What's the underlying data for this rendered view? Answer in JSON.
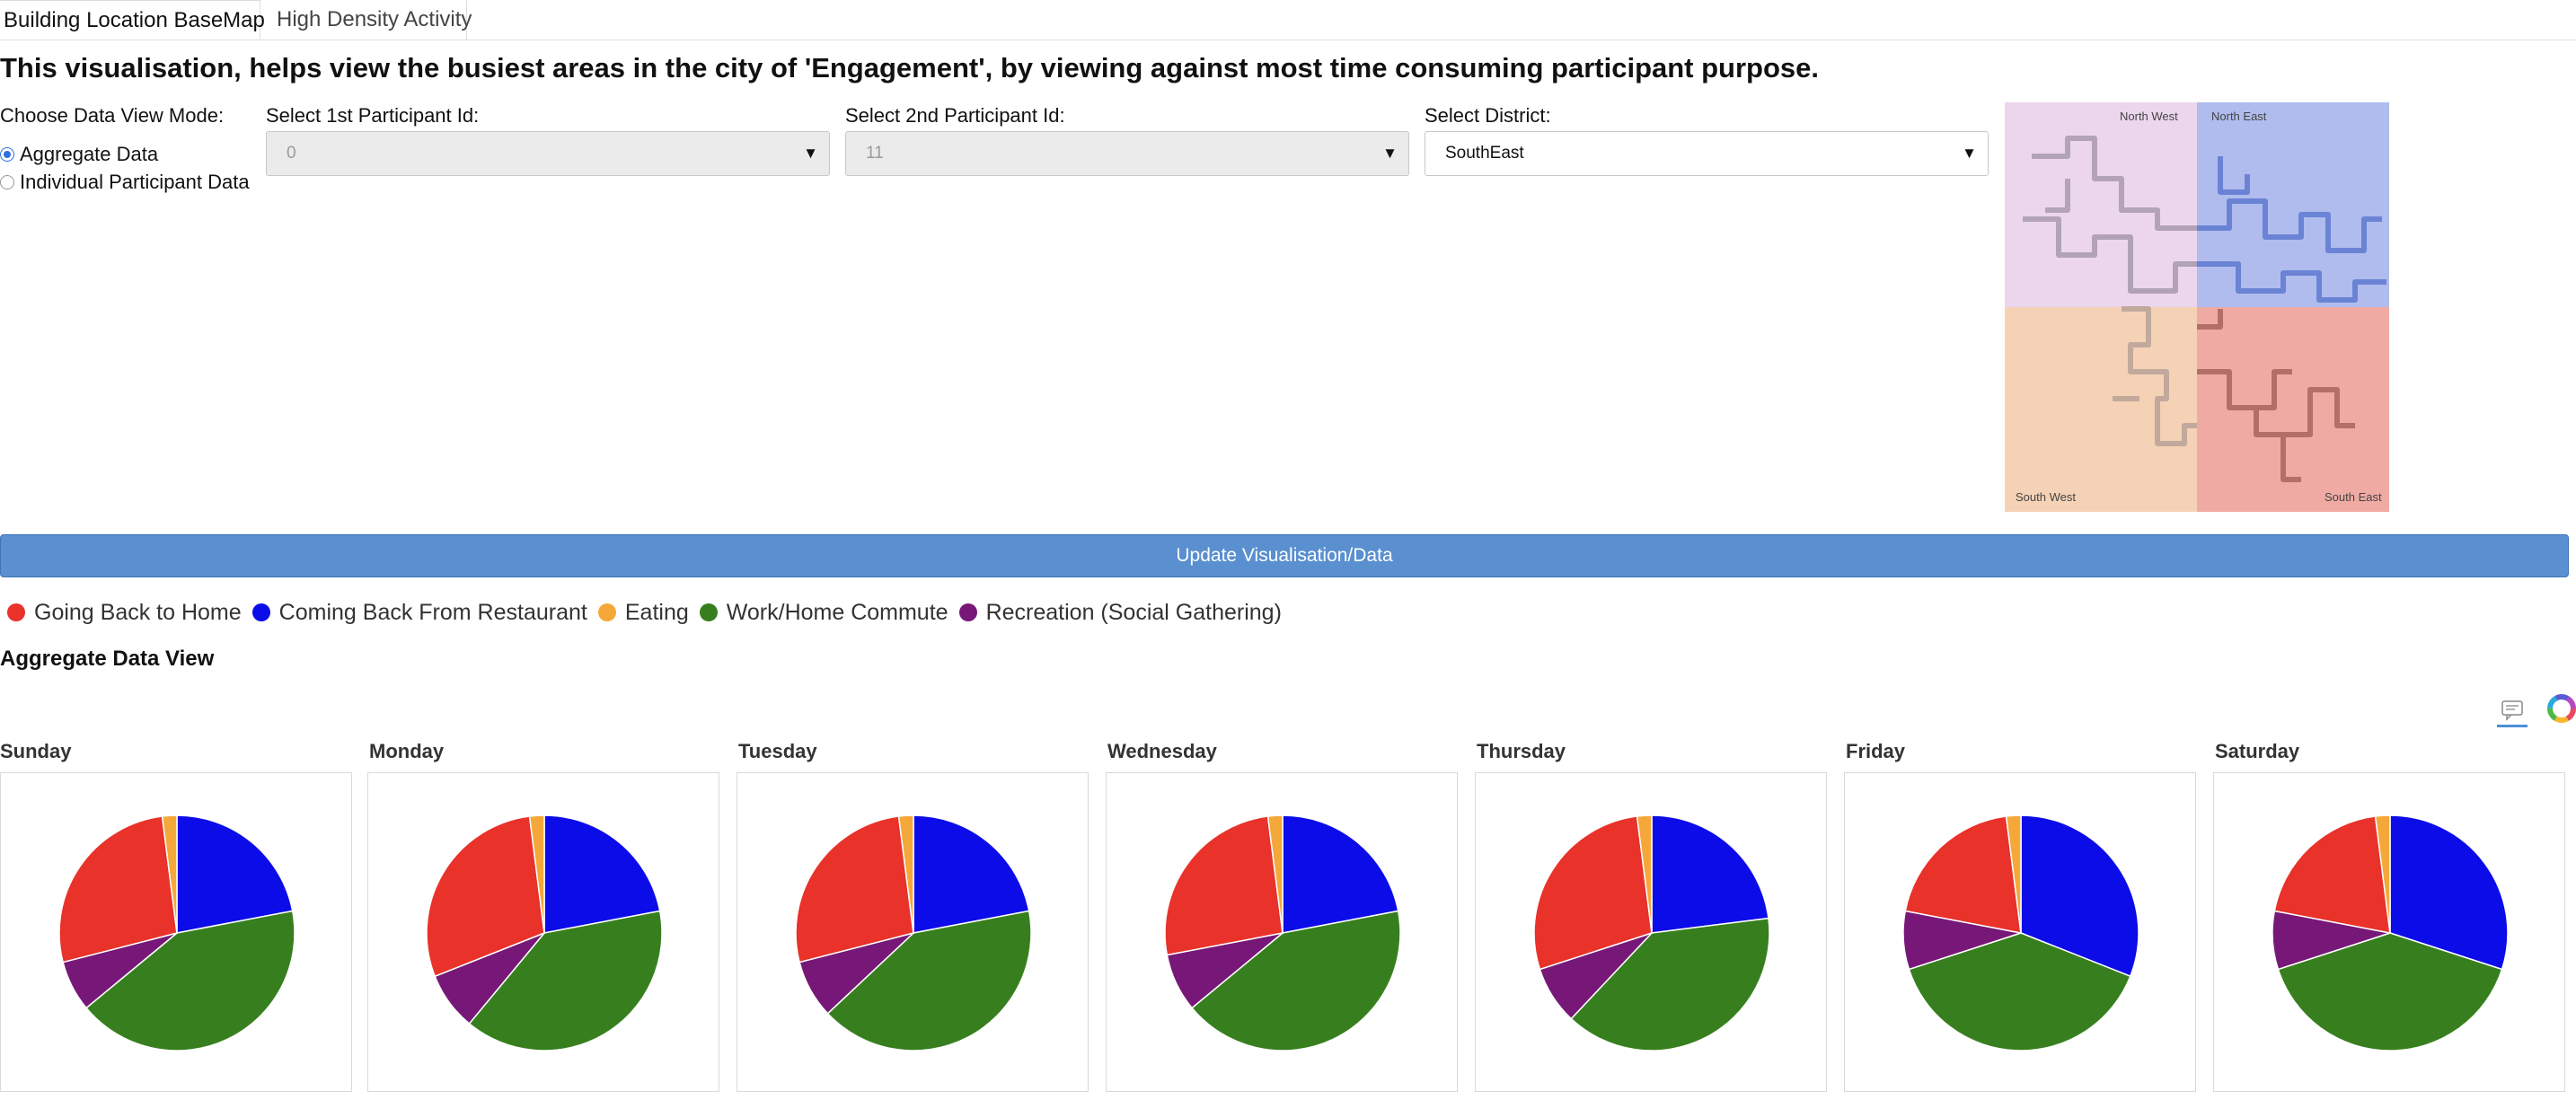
{
  "tabs": [
    "Building Location BaseMap",
    "High Density Activity"
  ],
  "heading": "This visualisation, helps view the busiest areas in the city of 'Engagement', by viewing against most time consuming participant purpose.",
  "controls": {
    "mode_label": "Choose Data View Mode:",
    "mode_options": [
      "Aggregate Data",
      "Individual Participant Data"
    ],
    "mode_selected": "Aggregate Data",
    "p1_label": "Select 1st Participant Id:",
    "p1_value": "0",
    "p2_label": "Select 2nd Participant Id:",
    "p2_value": "11",
    "district_label": "Select District:",
    "district_value": "SouthEast",
    "update_button": "Update Visualisation/Data"
  },
  "map": {
    "regions": [
      "North West",
      "North East",
      "South West",
      "South East"
    ],
    "colors": {
      "nw": "#ecd6ee",
      "ne": "#b0bcee",
      "sw": "#f5d2b6",
      "se": "#f0aaa4"
    }
  },
  "legend": [
    {
      "label": "Going Back to Home",
      "color": "#e8322a"
    },
    {
      "label": "Coming Back From Restaurant",
      "color": "#0c0ce8"
    },
    {
      "label": "Eating",
      "color": "#f4a83a"
    },
    {
      "label": "Work/Home Commute",
      "color": "#377f1e"
    },
    {
      "label": "Recreation (Social Gathering)",
      "color": "#771878"
    }
  ],
  "aggregate_title": "Aggregate Data View",
  "icons": {
    "comment": "comment-icon",
    "logo": "color-wheel-logo-icon"
  },
  "chart_data": [
    {
      "type": "pie",
      "title": "Sunday",
      "categories": [
        "Coming Back From Restaurant",
        "Work/Home Commute",
        "Recreation (Social Gathering)",
        "Going Back to Home",
        "Eating"
      ],
      "values": [
        22,
        42,
        7,
        27,
        2
      ]
    },
    {
      "type": "pie",
      "title": "Monday",
      "categories": [
        "Coming Back From Restaurant",
        "Work/Home Commute",
        "Recreation (Social Gathering)",
        "Going Back to Home",
        "Eating"
      ],
      "values": [
        22,
        39,
        8,
        29,
        2
      ]
    },
    {
      "type": "pie",
      "title": "Tuesday",
      "categories": [
        "Coming Back From Restaurant",
        "Work/Home Commute",
        "Recreation (Social Gathering)",
        "Going Back to Home",
        "Eating"
      ],
      "values": [
        22,
        41,
        8,
        27,
        2
      ]
    },
    {
      "type": "pie",
      "title": "Wednesday",
      "categories": [
        "Coming Back From Restaurant",
        "Work/Home Commute",
        "Recreation (Social Gathering)",
        "Going Back to Home",
        "Eating"
      ],
      "values": [
        22,
        42,
        8,
        26,
        2
      ]
    },
    {
      "type": "pie",
      "title": "Thursday",
      "categories": [
        "Coming Back From Restaurant",
        "Work/Home Commute",
        "Recreation (Social Gathering)",
        "Going Back to Home",
        "Eating"
      ],
      "values": [
        23,
        39,
        8,
        28,
        2
      ]
    },
    {
      "type": "pie",
      "title": "Friday",
      "categories": [
        "Coming Back From Restaurant",
        "Work/Home Commute",
        "Recreation (Social Gathering)",
        "Going Back to Home",
        "Eating"
      ],
      "values": [
        31,
        39,
        8,
        20,
        2
      ]
    },
    {
      "type": "pie",
      "title": "Saturday",
      "categories": [
        "Coming Back From Restaurant",
        "Work/Home Commute",
        "Recreation (Social Gathering)",
        "Going Back to Home",
        "Eating"
      ],
      "values": [
        30,
        40,
        8,
        20,
        2
      ]
    }
  ]
}
